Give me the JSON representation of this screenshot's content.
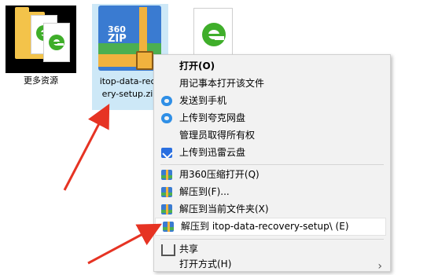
{
  "desktop": {
    "folder_label": "更多资源",
    "zip_badge": [
      "360",
      "ZIP"
    ],
    "zip_label_lines": [
      "itop-data-reco",
      "ery-setup.zip"
    ]
  },
  "menu": {
    "items": [
      {
        "label": "打开(O)",
        "bold": true,
        "icon": "none"
      },
      {
        "label": "用记事本打开该文件",
        "icon": "none"
      },
      {
        "label": "发送到手机",
        "icon": "cloud-icon"
      },
      {
        "label": "上传到夸克网盘",
        "icon": "cloud-icon"
      },
      {
        "label": "管理员取得所有权",
        "icon": "none"
      },
      {
        "label": "上传到迅雷云盘",
        "icon": "thunder-icon"
      },
      {
        "label": "用360压缩打开(Q)",
        "icon": "zip-icon"
      },
      {
        "label": "解压到(F)...",
        "icon": "zip-icon"
      },
      {
        "label": "解压到当前文件夹(X)",
        "icon": "zip-icon"
      },
      {
        "label": "解压到 itop-data-recovery-setup\\ (E)",
        "icon": "zip-icon",
        "highlighted": true
      },
      {
        "label": "共享",
        "icon": "share-icon"
      },
      {
        "label": "打开方式(H)",
        "icon": "none",
        "submenu": true
      }
    ]
  },
  "colors": {
    "menu_bg": "#f2f2f2",
    "selection": "#cde8f7",
    "arrow": "#e63323",
    "zip_blue": "#3a7bd1",
    "zip_gold": "#f1b23e"
  }
}
